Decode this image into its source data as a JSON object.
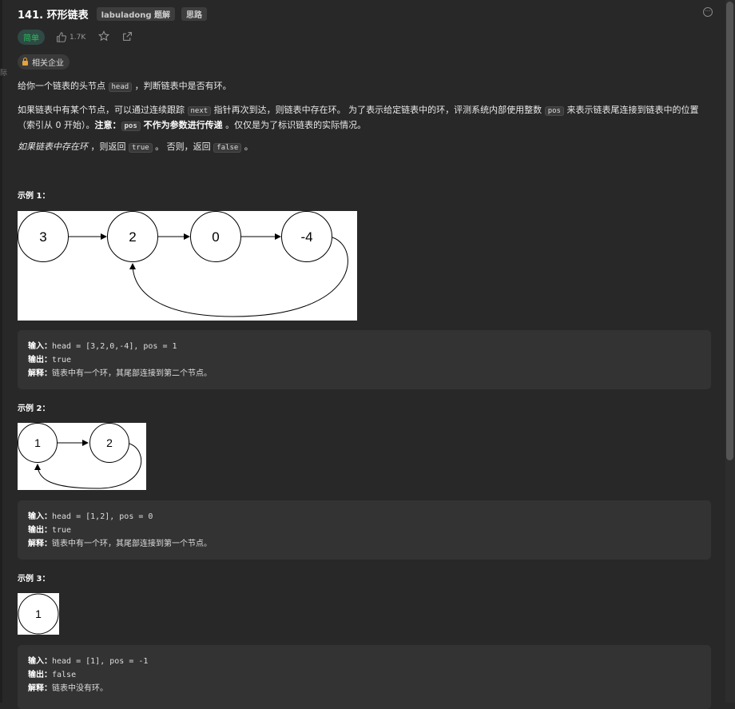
{
  "problem": {
    "title": "141. 环形链表",
    "tags": [
      "labuladong 题解",
      "思路"
    ],
    "difficulty": "简单",
    "likes": "1.7K",
    "companies_label": "相关企业"
  },
  "description": {
    "p1_a": "给你一个链表的头节点 ",
    "p1_code": "head",
    "p1_b": " ，判断链表中是否有环。",
    "p2_a": "如果链表中有某个节点，可以通过连续跟踪 ",
    "p2_code1": "next",
    "p2_b": " 指针再次到达，则链表中存在环。 为了表示给定链表中的环，评测系统内部使用整数 ",
    "p2_code2": "pos",
    "p2_c": " 来表示链表尾连接到链表中的位置（索引从 0 开始）。",
    "p2_note_label": "注意：",
    "p2_code3": "pos",
    "p2_note": " 不作为参数进行传递",
    "p2_d": " 。仅仅是为了标识链表的实际情况。",
    "p3_em": "如果链表中存在环",
    "p3_a": " ，则返回 ",
    "p3_code1": "true",
    "p3_b": " 。 否则，返回 ",
    "p3_code2": "false",
    "p3_c": " 。"
  },
  "examples": [
    {
      "heading": "示例 1：",
      "input_label": "输入：",
      "input": "head = [3,2,0,-4], pos = 1",
      "output_label": "输出：",
      "output": "true",
      "explain_label": "解释：",
      "explain": "链表中有一个环，其尾部连接到第二个节点。",
      "nodes": [
        "3",
        "2",
        "0",
        "-4"
      ]
    },
    {
      "heading": "示例 2：",
      "input_label": "输入：",
      "input": "head = [1,2], pos = 0",
      "output_label": "输出：",
      "output": "true",
      "explain_label": "解释：",
      "explain": "链表中有一个环，其尾部连接到第一个节点。",
      "nodes": [
        "1",
        "2"
      ]
    },
    {
      "heading": "示例 3：",
      "input_label": "输入：",
      "input": "head = [1], pos = -1",
      "output_label": "输出：",
      "output": "false",
      "explain_label": "解释：",
      "explain": "链表中没有环。",
      "nodes": [
        "1"
      ]
    }
  ],
  "colors": {
    "background": "#282828",
    "easy": "#2cbb5d",
    "lock": "#e6a23c"
  }
}
